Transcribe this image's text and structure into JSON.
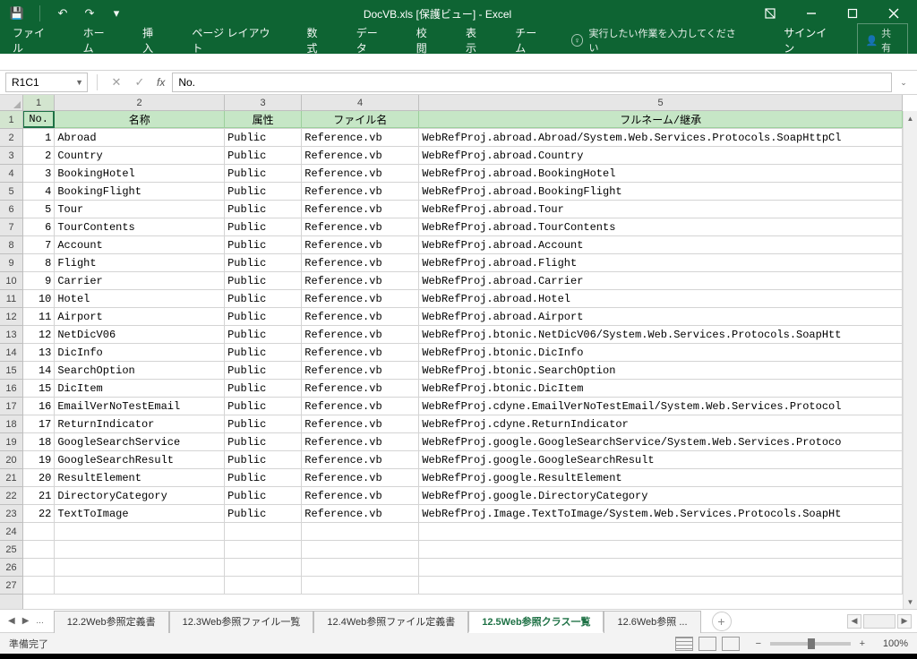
{
  "app": {
    "title_full": "DocVB.xls  [保護ビュー] - Excel"
  },
  "qat": {
    "save": "💾",
    "undo": "↶",
    "redo": "↷",
    "customize": "▾"
  },
  "ribbon": {
    "tabs": [
      "ファイル",
      "ホーム",
      "挿入",
      "ページ レイアウト",
      "数式",
      "データ",
      "校閲",
      "表示",
      "チーム"
    ],
    "tell_me": "実行したい作業を入力してください",
    "sign_in": "サインイン",
    "share": "共有"
  },
  "formula_bar": {
    "name_box": "R1C1",
    "formula": "No."
  },
  "col_labels": [
    "1",
    "2",
    "3",
    "4",
    "5"
  ],
  "headers": {
    "c1": "No.",
    "c2": "名称",
    "c3": "属性",
    "c4": "ファイル名",
    "c5": "フルネーム/継承"
  },
  "rows": [
    {
      "n": "1",
      "name": "Abroad",
      "attr": "Public",
      "file": "Reference.vb",
      "full": "WebRefProj.abroad.Abroad/System.Web.Services.Protocols.SoapHttpCl"
    },
    {
      "n": "2",
      "name": "Country",
      "attr": "Public",
      "file": "Reference.vb",
      "full": "WebRefProj.abroad.Country"
    },
    {
      "n": "3",
      "name": "BookingHotel",
      "attr": "Public",
      "file": "Reference.vb",
      "full": "WebRefProj.abroad.BookingHotel"
    },
    {
      "n": "4",
      "name": "BookingFlight",
      "attr": "Public",
      "file": "Reference.vb",
      "full": "WebRefProj.abroad.BookingFlight"
    },
    {
      "n": "5",
      "name": "Tour",
      "attr": "Public",
      "file": "Reference.vb",
      "full": "WebRefProj.abroad.Tour"
    },
    {
      "n": "6",
      "name": "TourContents",
      "attr": "Public",
      "file": "Reference.vb",
      "full": "WebRefProj.abroad.TourContents"
    },
    {
      "n": "7",
      "name": "Account",
      "attr": "Public",
      "file": "Reference.vb",
      "full": "WebRefProj.abroad.Account"
    },
    {
      "n": "8",
      "name": "Flight",
      "attr": "Public",
      "file": "Reference.vb",
      "full": "WebRefProj.abroad.Flight"
    },
    {
      "n": "9",
      "name": "Carrier",
      "attr": "Public",
      "file": "Reference.vb",
      "full": "WebRefProj.abroad.Carrier"
    },
    {
      "n": "10",
      "name": "Hotel",
      "attr": "Public",
      "file": "Reference.vb",
      "full": "WebRefProj.abroad.Hotel"
    },
    {
      "n": "11",
      "name": "Airport",
      "attr": "Public",
      "file": "Reference.vb",
      "full": "WebRefProj.abroad.Airport"
    },
    {
      "n": "12",
      "name": "NetDicV06",
      "attr": "Public",
      "file": "Reference.vb",
      "full": "WebRefProj.btonic.NetDicV06/System.Web.Services.Protocols.SoapHtt"
    },
    {
      "n": "13",
      "name": "DicInfo",
      "attr": "Public",
      "file": "Reference.vb",
      "full": "WebRefProj.btonic.DicInfo"
    },
    {
      "n": "14",
      "name": "SearchOption",
      "attr": "Public",
      "file": "Reference.vb",
      "full": "WebRefProj.btonic.SearchOption"
    },
    {
      "n": "15",
      "name": "DicItem",
      "attr": "Public",
      "file": "Reference.vb",
      "full": "WebRefProj.btonic.DicItem"
    },
    {
      "n": "16",
      "name": "EmailVerNoTestEmail",
      "attr": "Public",
      "file": "Reference.vb",
      "full": "WebRefProj.cdyne.EmailVerNoTestEmail/System.Web.Services.Protocol"
    },
    {
      "n": "17",
      "name": "ReturnIndicator",
      "attr": "Public",
      "file": "Reference.vb",
      "full": "WebRefProj.cdyne.ReturnIndicator"
    },
    {
      "n": "18",
      "name": "GoogleSearchService",
      "attr": "Public",
      "file": "Reference.vb",
      "full": "WebRefProj.google.GoogleSearchService/System.Web.Services.Protoco"
    },
    {
      "n": "19",
      "name": "GoogleSearchResult",
      "attr": "Public",
      "file": "Reference.vb",
      "full": "WebRefProj.google.GoogleSearchResult"
    },
    {
      "n": "20",
      "name": "ResultElement",
      "attr": "Public",
      "file": "Reference.vb",
      "full": "WebRefProj.google.ResultElement"
    },
    {
      "n": "21",
      "name": "DirectoryCategory",
      "attr": "Public",
      "file": "Reference.vb",
      "full": "WebRefProj.google.DirectoryCategory"
    },
    {
      "n": "22",
      "name": "TextToImage",
      "attr": "Public",
      "file": "Reference.vb",
      "full": "WebRefProj.Image.TextToImage/System.Web.Services.Protocols.SoapHt"
    }
  ],
  "empty_rows": [
    "24",
    "25",
    "26",
    "27"
  ],
  "sheets": {
    "tabs": [
      "12.2Web参照定義書",
      "12.3Web参照ファイル一覧",
      "12.4Web参照ファイル定義書",
      "12.5Web参照クラス一覧",
      "12.6Web参照 ..."
    ],
    "active_index": 3,
    "nav_prev": "◀",
    "nav_next": "▶",
    "nav_more": "...",
    "add": "+"
  },
  "status": {
    "ready": "準備完了",
    "zoom": "100%",
    "minus": "−",
    "plus": "+"
  }
}
